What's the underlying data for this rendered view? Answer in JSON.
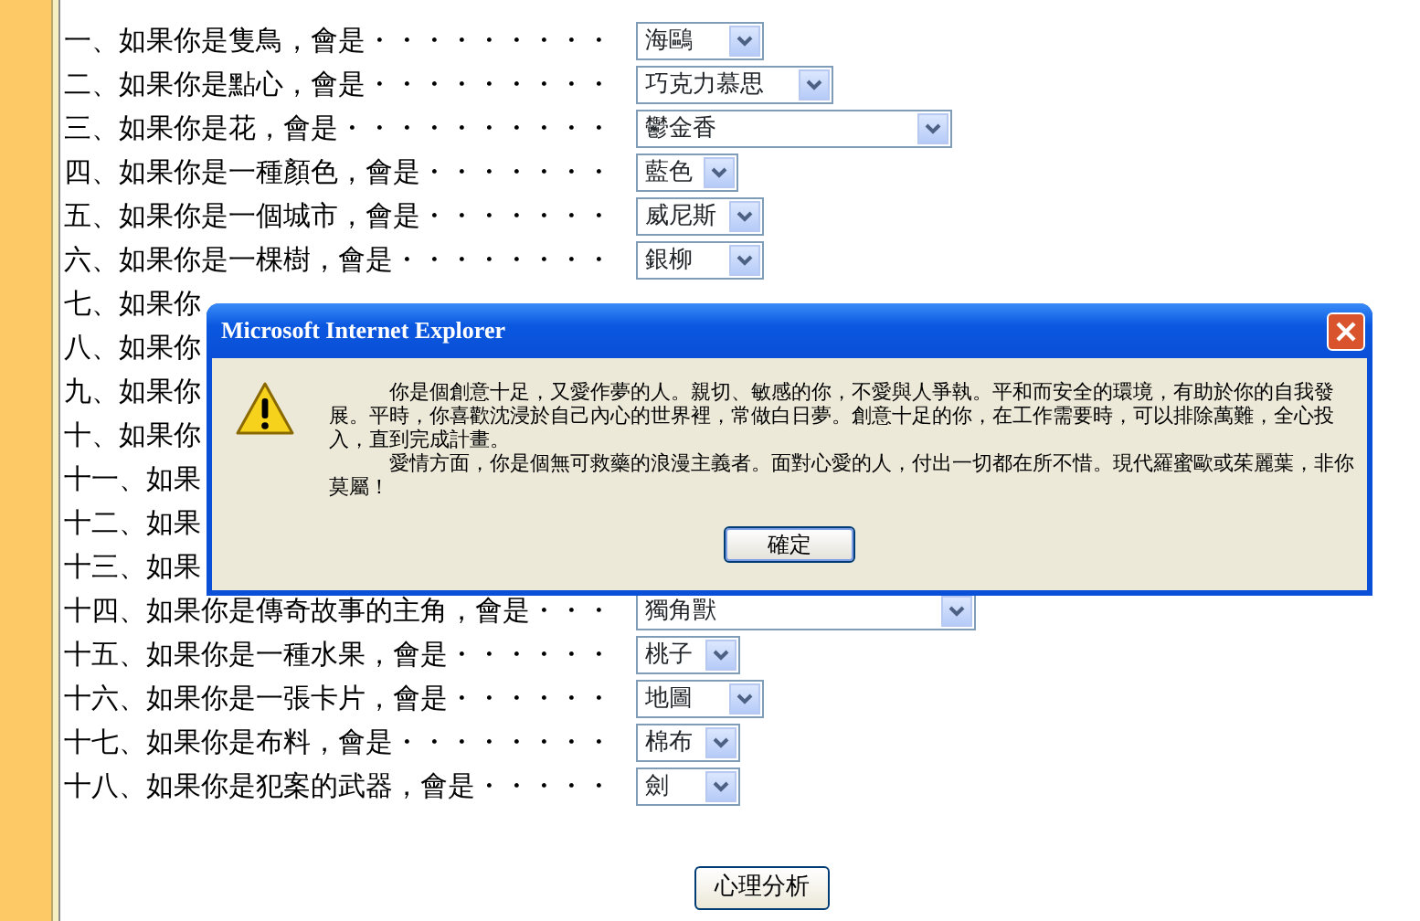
{
  "questions": [
    {
      "label": "一、如果你是隻鳥，會是・・・・・・・・・",
      "answer": "海鷗"
    },
    {
      "label": "二、如果你是點心，會是・・・・・・・・・",
      "answer": "巧克力慕思"
    },
    {
      "label": "三、如果你是花，會是・・・・・・・・・・",
      "answer": "鬱金香"
    },
    {
      "label": "四、如果你是一種顏色，會是・・・・・・・",
      "answer": "藍色"
    },
    {
      "label": "五、如果你是一個城市，會是・・・・・・・",
      "answer": "威尼斯"
    },
    {
      "label": "六、如果你是一棵樹，會是・・・・・・・・",
      "answer": "銀柳"
    },
    {
      "label": "七、如果你"
    },
    {
      "label": "八、如果你"
    },
    {
      "label": "九、如果你"
    },
    {
      "label": "十、如果你"
    },
    {
      "label": "十一、如果"
    },
    {
      "label": "十二、如果"
    },
    {
      "label": "十三、如果"
    },
    {
      "label": "十四、如果你是傳奇故事的主角，會是・・・",
      "answer": "獨角獸"
    },
    {
      "label": "十五、如果你是一種水果，會是・・・・・・",
      "answer": "桃子"
    },
    {
      "label": "十六、如果你是一張卡片，會是・・・・・・",
      "answer": "地圖"
    },
    {
      "label": "十七、如果你是布料，會是・・・・・・・・",
      "answer": "棉布"
    },
    {
      "label": "十八、如果你是犯案的武器，會是・・・・・",
      "answer": "劍"
    }
  ],
  "submit_button": "心理分析",
  "dialog": {
    "title": "Microsoft Internet Explorer",
    "paragraphs": [
      "你是個創意十足，又愛作夢的人。親切、敏感的你，不愛與人爭執。平和而安全的環境，有助於你的自我發展。平時，你喜歡沈浸於自己內心的世界裡，常做白日夢。創意十足的你，在工作需要時，可以排除萬難，全心投入，直到完成計畫。",
      "愛情方面，你是個無可救藥的浪漫主義者。面對心愛的人，付出一切都在所不惜。現代羅蜜歐或茱麗葉，非你莫屬！"
    ],
    "ok_button": "確定"
  }
}
